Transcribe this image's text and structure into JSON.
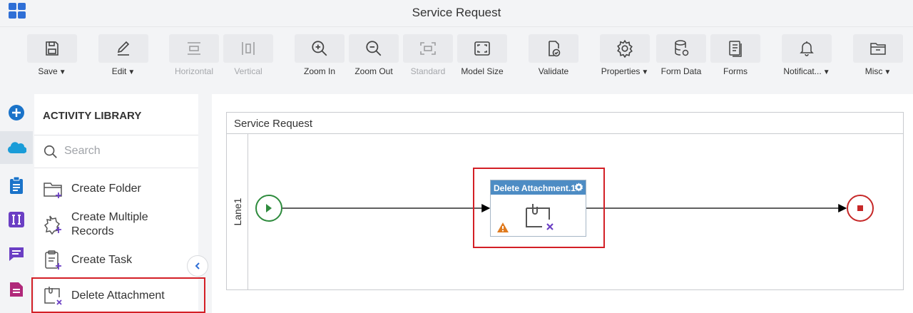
{
  "window": {
    "title": "Service Request"
  },
  "toolbar": {
    "items": [
      {
        "label": "Save",
        "icon": "save-icon",
        "has_dropdown": true,
        "enabled": true
      },
      {
        "label": "Edit",
        "icon": "edit-icon",
        "has_dropdown": true,
        "enabled": true
      },
      {
        "label": "Horizontal",
        "icon": "horizontal-icon",
        "has_dropdown": false,
        "enabled": false
      },
      {
        "label": "Vertical",
        "icon": "vertical-icon",
        "has_dropdown": false,
        "enabled": false
      },
      {
        "label": "Zoom In",
        "icon": "zoom-in-icon",
        "has_dropdown": false,
        "enabled": true
      },
      {
        "label": "Zoom Out",
        "icon": "zoom-out-icon",
        "has_dropdown": false,
        "enabled": true
      },
      {
        "label": "Standard",
        "icon": "standard-icon",
        "has_dropdown": false,
        "enabled": false
      },
      {
        "label": "Model Size",
        "icon": "model-size-icon",
        "has_dropdown": false,
        "enabled": true
      },
      {
        "label": "Validate",
        "icon": "validate-icon",
        "has_dropdown": false,
        "enabled": true
      },
      {
        "label": "Properties",
        "icon": "gear-icon",
        "has_dropdown": true,
        "enabled": true
      },
      {
        "label": "Form Data",
        "icon": "database-icon",
        "has_dropdown": false,
        "enabled": true
      },
      {
        "label": "Forms",
        "icon": "forms-icon",
        "has_dropdown": false,
        "enabled": true
      },
      {
        "label": "Notificat...",
        "icon": "bell-icon",
        "has_dropdown": true,
        "enabled": true
      },
      {
        "label": "Misc",
        "icon": "folder-icon",
        "has_dropdown": true,
        "enabled": true
      }
    ]
  },
  "rail": {
    "items": [
      {
        "icon": "add-icon",
        "color": "#1a73c9"
      },
      {
        "icon": "salesforce-icon",
        "color": "#1a9cd8",
        "active": true
      },
      {
        "icon": "clipboard-icon",
        "color": "#1a73c9"
      },
      {
        "icon": "text-field-icon",
        "color": "#6b3fc4"
      },
      {
        "icon": "chat-icon",
        "color": "#6b3fc4"
      },
      {
        "icon": "document-icon",
        "color": "#b0287a"
      }
    ]
  },
  "library": {
    "title": "ACTIVITY LIBRARY",
    "search_placeholder": "Search",
    "items": [
      {
        "label": "Create Folder",
        "icon": "create-folder-icon"
      },
      {
        "label": "Create Multiple Records",
        "icon": "create-multiple-records-icon"
      },
      {
        "label": "Create Task",
        "icon": "create-task-icon"
      },
      {
        "label": "Delete Attachment",
        "icon": "delete-attachment-icon",
        "highlighted": true
      }
    ]
  },
  "canvas": {
    "pool_title": "Service Request",
    "lane_label": "Lane1",
    "task": {
      "title": "Delete Attachment.1",
      "warning": true,
      "highlighted": true
    },
    "start_event": {
      "color": "#2e8b3d"
    },
    "end_event": {
      "color": "#c62828"
    }
  },
  "colors": {
    "accent": "#2f6fd6",
    "highlight": "#d31f26",
    "task_header": "#4d8cc4"
  }
}
